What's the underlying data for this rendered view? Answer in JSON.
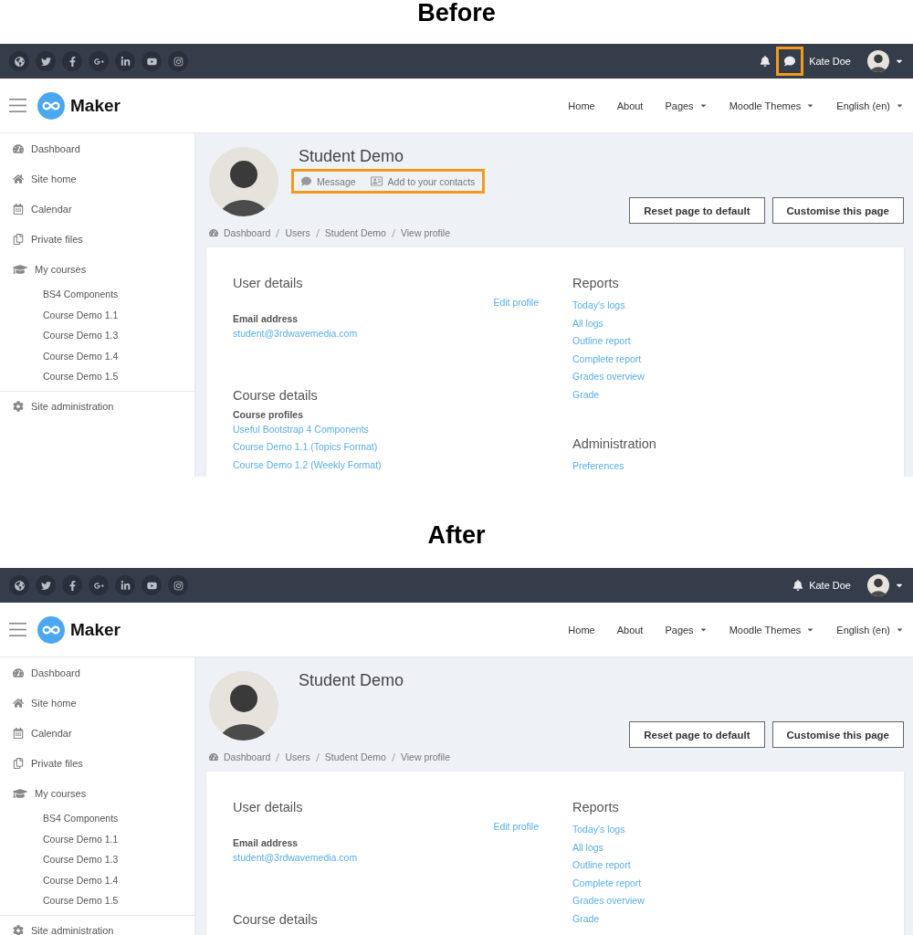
{
  "panels": [
    {
      "heading": "Before",
      "topbar": {
        "messages_button": {
          "highlighted": true
        },
        "user_name": "Kate Doe"
      },
      "navbar": {
        "brand": "Maker",
        "links": [
          {
            "label": "Home",
            "dropdown": false
          },
          {
            "label": "About",
            "dropdown": false
          },
          {
            "label": "Pages",
            "dropdown": true
          },
          {
            "label": "Moodle Themes",
            "dropdown": true
          },
          {
            "label": "English (en)",
            "dropdown": true
          }
        ]
      },
      "sidebar": {
        "items": [
          "Dashboard",
          "Site home",
          "Calendar",
          "Private files",
          "My courses"
        ],
        "courses": [
          "BS4 Components",
          "Course Demo 1.1",
          "Course Demo 1.3",
          "Course Demo 1.4",
          "Course Demo 1.5"
        ],
        "admin": "Site administration"
      },
      "profile": {
        "name": "Student Demo",
        "actions": {
          "highlighted": true,
          "items": [
            {
              "kind": "message",
              "label": "Message"
            },
            {
              "kind": "contact",
              "label": "Add to your contacts"
            }
          ]
        },
        "buttons": [
          "Reset page to default",
          "Customise this page"
        ],
        "breadcrumb": [
          "Dashboard",
          "Users",
          "Student Demo",
          "View profile"
        ]
      },
      "card": {
        "left": [
          {
            "title": "User details",
            "action": "Edit profile",
            "fields": [
              {
                "label": "Email address",
                "links": [
                  "student@3rdwavemedia.com"
                ]
              }
            ]
          },
          {
            "title": "Course details",
            "fields": [
              {
                "label": "Course profiles",
                "links": [
                  "Useful Bootstrap 4 Components",
                  "Course Demo 1.1 (Topics Format)",
                  "Course Demo 1.2 (Weekly Format)"
                ]
              }
            ]
          }
        ],
        "right": [
          {
            "title": "Reports",
            "links": [
              "Today's logs",
              "All logs",
              "Outline report",
              "Complete report",
              "Grades overview",
              "Grade"
            ]
          },
          {
            "title": "Administration",
            "links": [
              "Preferences"
            ]
          }
        ]
      }
    },
    {
      "heading": "After",
      "topbar": {
        "user_name": "Kate Doe"
      },
      "navbar": {
        "brand": "Maker",
        "links": [
          {
            "label": "Home",
            "dropdown": false
          },
          {
            "label": "About",
            "dropdown": false
          },
          {
            "label": "Pages",
            "dropdown": true
          },
          {
            "label": "Moodle Themes",
            "dropdown": true
          },
          {
            "label": "English (en)",
            "dropdown": true
          }
        ]
      },
      "sidebar": {
        "items": [
          "Dashboard",
          "Site home",
          "Calendar",
          "Private files",
          "My courses"
        ],
        "courses": [
          "BS4 Components",
          "Course Demo 1.1",
          "Course Demo 1.3",
          "Course Demo 1.4",
          "Course Demo 1.5"
        ],
        "admin": "Site administration"
      },
      "profile": {
        "name": "Student Demo",
        "buttons": [
          "Reset page to default",
          "Customise this page"
        ],
        "breadcrumb": [
          "Dashboard",
          "Users",
          "Student Demo",
          "View profile"
        ]
      },
      "card": {
        "left": [
          {
            "title": "User details",
            "action": "Edit profile",
            "fields": [
              {
                "label": "Email address",
                "links": [
                  "student@3rdwavemedia.com"
                ]
              }
            ]
          },
          {
            "title": "Course details"
          }
        ],
        "right": [
          {
            "title": "Reports",
            "links": [
              "Today's logs",
              "All logs",
              "Outline report",
              "Complete report",
              "Grades overview",
              "Grade"
            ]
          }
        ]
      }
    }
  ]
}
